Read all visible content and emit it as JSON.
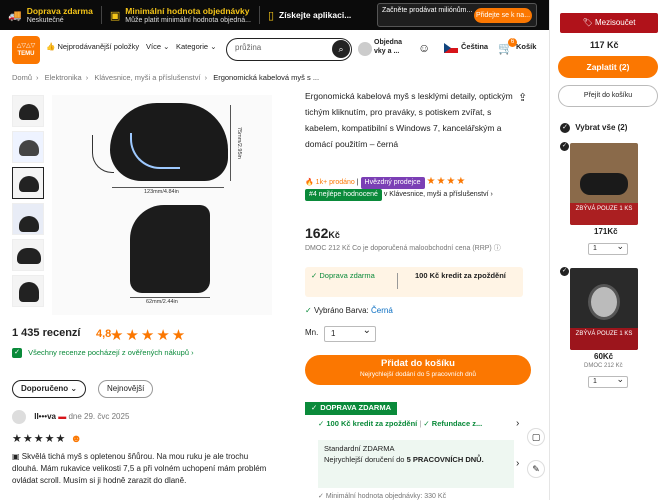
{
  "promo": {
    "free_shipping_title": "Doprava zdarma",
    "free_shipping_sub": "Neskutečné",
    "min_order_title": "Minimální hodnota objednávky",
    "min_order_sub": "Může platit minimální hodnota objedná...",
    "app_cta": "Získejte aplikaci...",
    "banner_text": "Začněte prodávat miliónům...",
    "banner_button": "Přidejte se k na..."
  },
  "header": {
    "logo_text": "TEMU",
    "nav_best": "Nejprodávanější položky",
    "nav_more": "Více",
    "nav_categories": "Kategorie",
    "search_placeholder": "průžina",
    "account": "Objedna vky a ...",
    "language": "Čeština",
    "cart": "Košík",
    "cart_count": "6"
  },
  "breadcrumb": [
    "Domů",
    "Elektronika",
    "Klávesnice, myši a příslušenství",
    "Ergonomická kabelová myš s ..."
  ],
  "gallery": {
    "dim_width": "123mm/4.84in",
    "dim_height": "75mm/2.95in",
    "dim_bottom": "62mm/2.44in"
  },
  "reviews": {
    "heading": "1 435 recenzí",
    "score": "4,8",
    "stars": "★★★★★",
    "verified": "Všechny recenze pocházejí z ověřených nákupů",
    "filter_recommended": "Doporučeno",
    "filter_newest": "Nejnovější",
    "reviewer_name": "II•••va",
    "review_date": "dne 29. čvc 2025",
    "review_stars": "★★★★★",
    "review_text": "Skvělá tichá myš s opletenou šňůrou. Na mou ruku je ale trochu dlouhá. Mám rukavice velikosti 7,5 a při volném uchopení mám problém ovládat scroll. Musím si ji hodně zarazit do dlaně."
  },
  "product": {
    "title": "Ergonomická kabelová myš s lesklými detaily, optickým tichým kliknutím, pro praváky, s potiskem zvířat, s kabelem, kompatibilní s Windows 7, kancelářským a domácí použitím – černá",
    "tag_sold": "1k+ prodáno",
    "tag_store": "Hvězdný prodejce",
    "tag_stars": "★★★★",
    "tag_rank": "#4 nejlépe hodnocené",
    "tag_category": "v Klávesnice, myši a příslušenství",
    "price_main": "162",
    "price_currency": "Kč",
    "rrp": "DMOC 212 Kč Co je doporučená maloobchodní cena (RRP)",
    "ship_free": "Doprava zdarma",
    "ship_credit": "100 Kč kredit za zpoždění",
    "chosen_label": "Vybráno Barva:",
    "chosen_value": "Černá",
    "qty_label": "Mn.",
    "qty_value": "1",
    "add_to_cart": "Přidat do košíku",
    "add_to_cart_sub": "Nejrychlejší dodání do 5 pracovních dnů",
    "free_ship_badge": "DOPRAVA ZDARMA",
    "credit_line": "100 Kč kredit za zpoždění",
    "refund_line": "Refundace z...",
    "standard": "Standardní ZDARMA",
    "delivery_prefix": "Nejrychlejší doručení do",
    "delivery_days": "5 PRACOVNÍCH DNŮ.",
    "min_order": "Minimální hodnota objednávky: 330 Kč"
  },
  "cart_panel": {
    "discount": "Mezisoučet",
    "total": "117 Kč",
    "pay": "Zaplatit (2)",
    "go_cart": "Přejít do košíku",
    "select_all": "Vybrat vše (2)",
    "items": [
      {
        "badge": "ZBÝVÁ POUZE 1 KS",
        "price": "171Kč",
        "rrp": "",
        "qty": "1"
      },
      {
        "badge": "ZBÝVÁ POUZE 1 KS",
        "price": "60Kč",
        "rrp": "DMOC 212 Kč",
        "qty": "1"
      }
    ]
  },
  "colors": {
    "accent": "#fb7701",
    "green": "#0a8a3a",
    "red": "#b0121a"
  }
}
